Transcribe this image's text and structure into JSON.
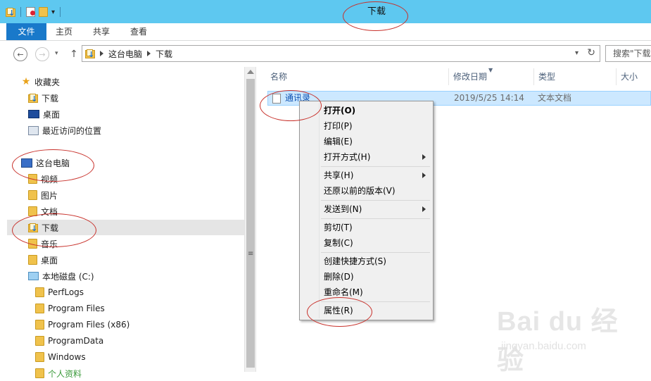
{
  "window": {
    "title": "下载"
  },
  "ribbon": {
    "tabs": [
      "文件",
      "主页",
      "共享",
      "查看"
    ]
  },
  "address": {
    "segments": [
      "这台电脑",
      "下载"
    ],
    "search_placeholder": "搜索\"下载\""
  },
  "nav": {
    "items": [
      {
        "label": "收藏夹",
        "icon": "star-icon"
      },
      {
        "label": "下载",
        "icon": "downloads-folder-icon"
      },
      {
        "label": "桌面",
        "icon": "desktop-icon"
      },
      {
        "label": "最近访问的位置",
        "icon": "recent-places-icon"
      },
      {
        "label": "这台电脑",
        "icon": "this-pc-icon"
      },
      {
        "label": "视频",
        "icon": "videos-folder-icon"
      },
      {
        "label": "图片",
        "icon": "pictures-folder-icon"
      },
      {
        "label": "文档",
        "icon": "documents-folder-icon"
      },
      {
        "label": "下载",
        "icon": "downloads-folder-icon",
        "selected": true
      },
      {
        "label": "音乐",
        "icon": "music-folder-icon"
      },
      {
        "label": "桌面",
        "icon": "desktop-folder-icon"
      },
      {
        "label": "本地磁盘 (C:)",
        "icon": "drive-icon"
      },
      {
        "label": "PerfLogs",
        "icon": "folder-icon"
      },
      {
        "label": "Program Files",
        "icon": "folder-icon"
      },
      {
        "label": "Program Files (x86)",
        "icon": "folder-icon"
      },
      {
        "label": "ProgramData",
        "icon": "folder-icon"
      },
      {
        "label": "Windows",
        "icon": "folder-icon"
      },
      {
        "label": "个人资料",
        "icon": "folder-icon"
      }
    ]
  },
  "columns": [
    "名称",
    "修改日期",
    "类型",
    "大小"
  ],
  "files": [
    {
      "name": "通讯录",
      "modified": "2019/5/25 14:14",
      "type": "文本文档"
    }
  ],
  "context_menu": {
    "items": [
      {
        "label": "打开(O)",
        "bold": true
      },
      {
        "label": "打印(P)"
      },
      {
        "label": "编辑(E)"
      },
      {
        "label": "打开方式(H)",
        "submenu": true
      },
      {
        "label": "共享(H)",
        "submenu": true
      },
      {
        "label": "还原以前的版本(V)"
      },
      {
        "label": "发送到(N)",
        "submenu": true
      },
      {
        "label": "剪切(T)"
      },
      {
        "label": "复制(C)"
      },
      {
        "label": "创建快捷方式(S)"
      },
      {
        "label": "删除(D)"
      },
      {
        "label": "重命名(M)"
      },
      {
        "label": "属性(R)"
      }
    ]
  },
  "watermark": {
    "brand": "Bai du 经验",
    "url": "jingyan.baidu.com"
  },
  "colors": {
    "titlebar": "#5ec8f0",
    "file_tab": "#1979ca",
    "selection": "#cce8ff",
    "annotation": "#c8312b"
  }
}
